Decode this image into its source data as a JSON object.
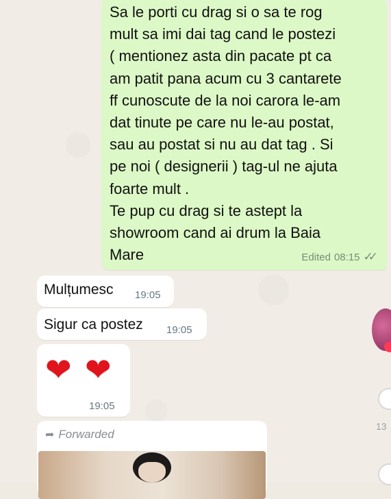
{
  "chat": {
    "outgoing_message": {
      "text": "Sa le porti cu drag si o sa te rog\nmult sa imi dai tag cand le postezi\n( mentionez asta din pacate pt ca\nam patit pana acum cu 3 cantarete\nff cunoscute de la noi carora le-am\ndat tinute pe care nu le-au postat,\nsau au postat si nu au dat tag . Si\npe noi ( designerii ) tag-ul ne ajuta\nfoarte mult .\nTe pup cu drag si te astept la\nshowroom cand ai drum la Baia\nMare",
      "status": "Edited",
      "time": "08:15",
      "read_icon": "double-check-icon"
    },
    "incoming_messages": [
      {
        "text": "Mulțumesc",
        "time": "19:05"
      },
      {
        "text": "Sigur ca postez",
        "time": "19:05"
      },
      {
        "emoji": "❤❤",
        "time": "19:05"
      }
    ],
    "forwarded": {
      "label": "Forwarded",
      "icon": "forward-arrow-icon"
    },
    "side": {
      "count": "13"
    }
  }
}
